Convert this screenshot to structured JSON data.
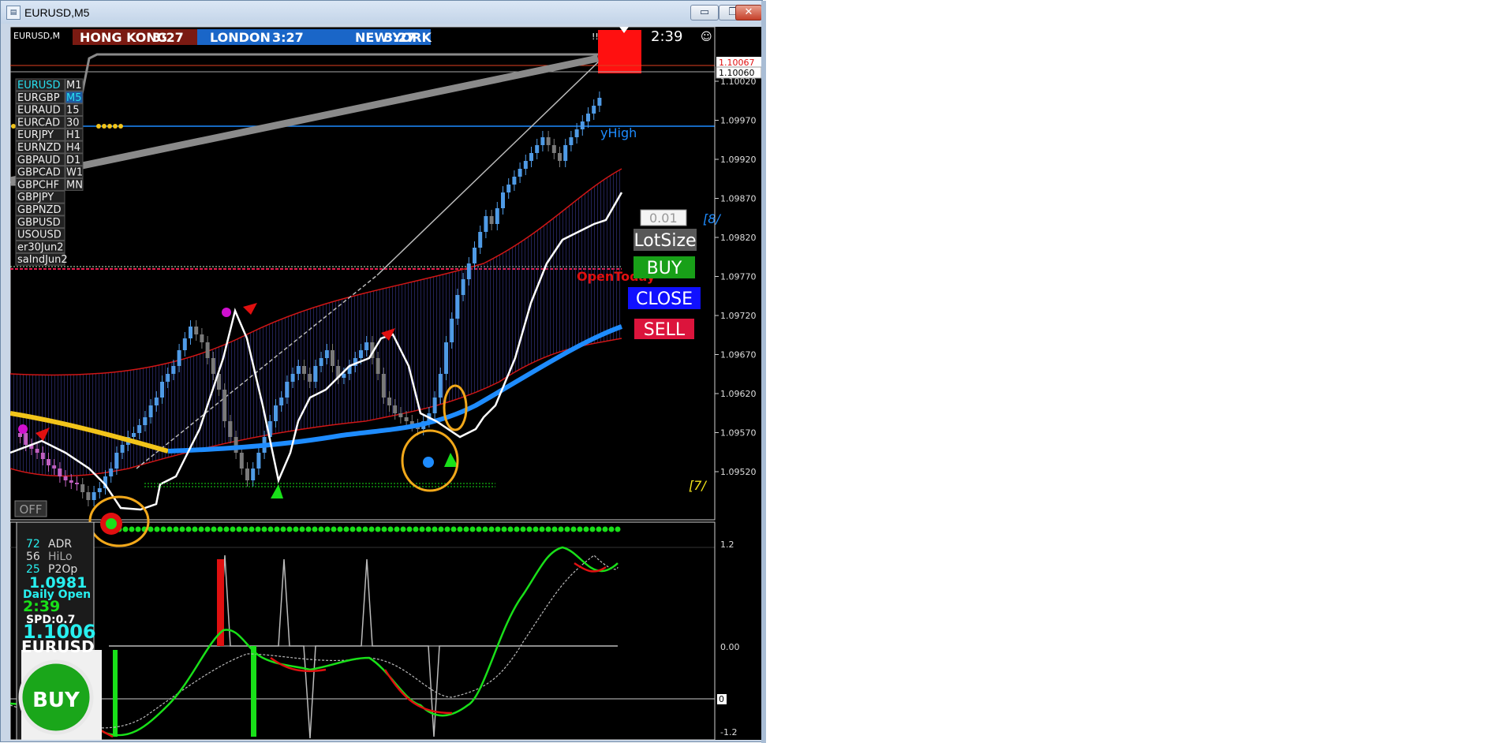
{
  "window": {
    "title": "EURUSD,M5",
    "icon": "chart-window-icon"
  },
  "titlebar_buttons": {
    "minimize": "▭",
    "restore": "❐",
    "close": "✕"
  },
  "header": {
    "symbol": "EURUSD,M",
    "sessions": [
      {
        "label": "HONG KONG",
        "time": "3:27",
        "color": "#7a1a12"
      },
      {
        "label": "LONDON",
        "time": "3:27",
        "color": "#1a66c8"
      },
      {
        "label": "NEW YORK",
        "time": "3:27",
        "color": "#1a66c8"
      }
    ],
    "autotrade": "!!! ...ADE",
    "countdown": "2:39",
    "smiley_icon": "smiley-icon"
  },
  "price_axis": {
    "labels": [
      "1.10020",
      "1.09970",
      "1.09920",
      "1.09870",
      "1.09820",
      "1.09770",
      "1.09720",
      "1.09670",
      "1.09620",
      "1.09570",
      "1.09520"
    ],
    "marker_red": "1.10067",
    "marker_current": "1.10060"
  },
  "indicator_axis": {
    "labels": [
      "1.2",
      "0.00",
      "0",
      "-1.2"
    ]
  },
  "symbols": [
    "EURUSD",
    "EURGBP",
    "EURAUD",
    "EURCAD",
    "EURJPY",
    "EURNZD",
    "GBPAUD",
    "GBPCAD",
    "GBPCHF",
    "GBPJPY",
    "GBPNZD",
    "GBPUSD",
    "USOUSD",
    "er30Jun2",
    "saIndJun2"
  ],
  "timeframes": [
    "M1",
    "M5",
    "15",
    "30",
    "H1",
    "H4",
    "D1",
    "W1",
    "MN"
  ],
  "off_label": "OFF",
  "chart_labels": {
    "high": "yHigh",
    "open_today": "OpenToday",
    "bracket_top": "[8/",
    "bracket_bottom": "[7/"
  },
  "trade_panel": {
    "lot": "0.01",
    "lotsize": "LotSize",
    "buy": "BUY",
    "close": "CLOSE",
    "sell": "SELL"
  },
  "info_box": {
    "rows": [
      {
        "value": "72",
        "label": "ADR"
      },
      {
        "value": "56",
        "label": "HiLo"
      },
      {
        "value": "25",
        "label": "P2Op"
      }
    ],
    "daily_open_value": "1.0981",
    "daily_open_label": "Daily Open",
    "timer": "2:39",
    "spread": "SPD:0.7",
    "price": "1.1006",
    "symbol": "EURUSD",
    "signal": "BUY"
  },
  "colors": {
    "bull": "#4f9be6",
    "bear": "#7a7a7a",
    "band": "#d01616",
    "ma": "#1e8cff",
    "ma_yellow": "#f2c41a",
    "support": "#19e019",
    "buy_green": "#18a018",
    "sell_red": "#dc143c",
    "close_blue": "#1010ff"
  }
}
